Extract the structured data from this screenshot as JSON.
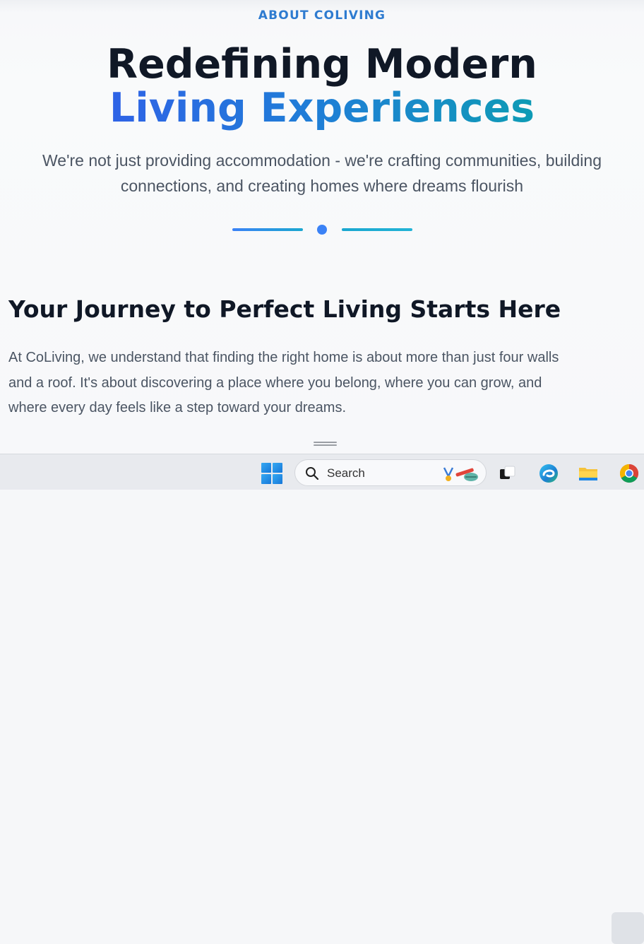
{
  "hero": {
    "eyebrow": "ABOUT COLIVING",
    "title_line1": "Redefining Modern",
    "title_line2": "Living Experiences",
    "subtitle_line1": "We're not just providing accommodation - we're crafting communities, building",
    "subtitle_line2": "connections, and creating homes where dreams flourish"
  },
  "section": {
    "heading": "Your Journey to Perfect Living Starts Here",
    "body_line1": "At CoLiving, we understand that finding the right home is about more than just four walls",
    "body_line2": "and a roof. It's about discovering a place where you belong, where you can grow, and",
    "body_line3": "where every day feels like a step toward your dreams."
  },
  "taskbar": {
    "search_placeholder": "Search",
    "icons": [
      "windows-start-icon",
      "search-icon",
      "task-view-icon",
      "edge-icon",
      "file-explorer-icon",
      "chrome-icon"
    ]
  },
  "colors": {
    "accent_blue": "#3b82f6",
    "accent_cyan": "#0e9bb5",
    "heading": "#101826",
    "body_text": "#4b5563"
  }
}
